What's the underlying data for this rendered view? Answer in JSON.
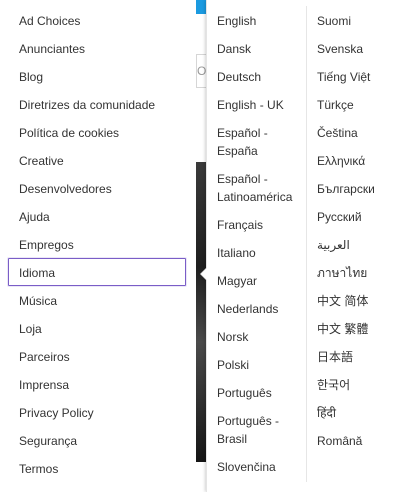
{
  "background": {
    "search_fragment": "O"
  },
  "left_menu": {
    "items": [
      {
        "label": "Ad Choices"
      },
      {
        "label": "Anunciantes"
      },
      {
        "label": "Blog"
      },
      {
        "label": "Diretrizes da comunidade"
      },
      {
        "label": "Política de cookies"
      },
      {
        "label": "Creative"
      },
      {
        "label": "Desenvolvedores"
      },
      {
        "label": "Ajuda"
      },
      {
        "label": "Empregos"
      },
      {
        "label": "Idioma",
        "selected": true
      },
      {
        "label": "Música"
      },
      {
        "label": "Loja"
      },
      {
        "label": "Parceiros"
      },
      {
        "label": "Imprensa"
      },
      {
        "label": "Privacy Policy"
      },
      {
        "label": "Segurança"
      },
      {
        "label": "Termos"
      }
    ]
  },
  "languages": {
    "column1": [
      {
        "label": "English"
      },
      {
        "label": "Dansk"
      },
      {
        "label": "Deutsch"
      },
      {
        "label": "English - UK"
      },
      {
        "label": "Español - España"
      },
      {
        "label": "Español - Latinoamérica"
      },
      {
        "label": "Français"
      },
      {
        "label": "Italiano"
      },
      {
        "label": "Magyar"
      },
      {
        "label": "Nederlands"
      },
      {
        "label": "Norsk"
      },
      {
        "label": "Polski"
      },
      {
        "label": "Português"
      },
      {
        "label": "Português - Brasil"
      },
      {
        "label": "Slovenčina"
      }
    ],
    "column2": [
      {
        "label": "Suomi"
      },
      {
        "label": "Svenska"
      },
      {
        "label": "Tiếng Việt"
      },
      {
        "label": "Türkçe"
      },
      {
        "label": "Čeština"
      },
      {
        "label": "Ελληνικά"
      },
      {
        "label": "Български"
      },
      {
        "label": "Русский"
      },
      {
        "label": "العربية"
      },
      {
        "label": "ภาษาไทย"
      },
      {
        "label": "中文 简体"
      },
      {
        "label": "中文 繁體"
      },
      {
        "label": "日本語"
      },
      {
        "label": "한국어"
      },
      {
        "label": "हिंदी"
      },
      {
        "label": "Română"
      }
    ]
  },
  "colors": {
    "selected_border": "#7a5dc7",
    "brand_blue": "#1b9ae0"
  }
}
